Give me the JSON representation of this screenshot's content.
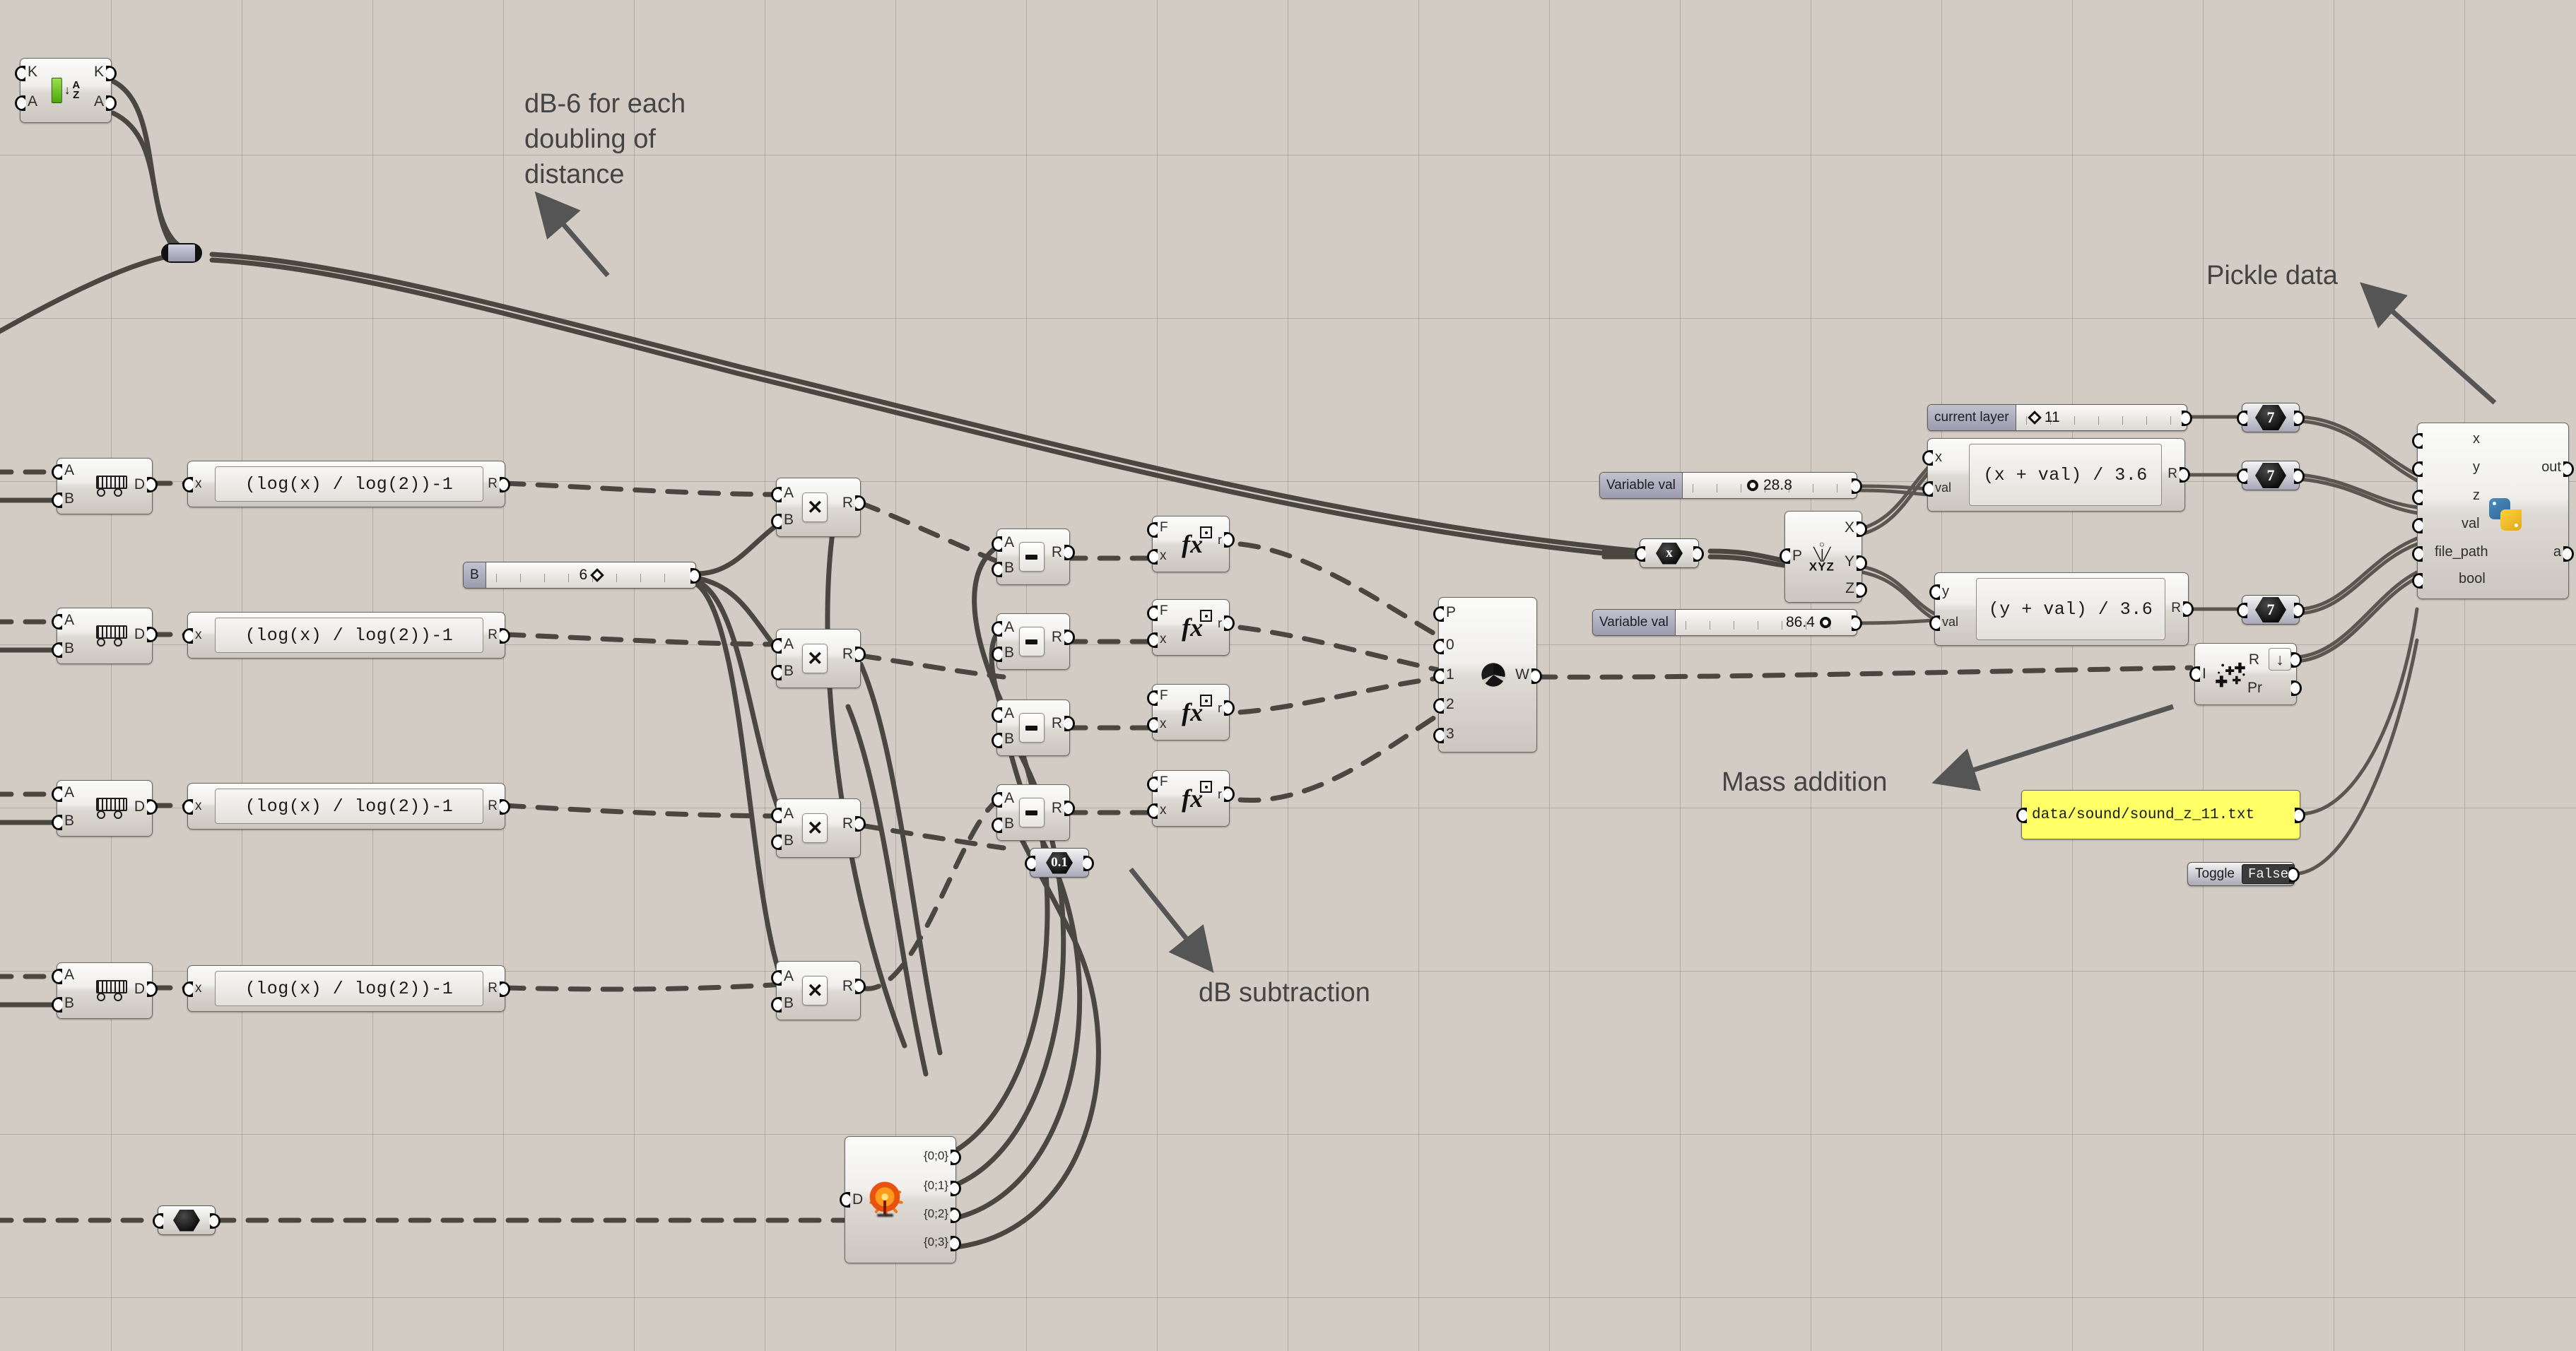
{
  "app": {
    "canvas_background": "#d3ccc4",
    "grid_line_color": "#827a70"
  },
  "annotations": [
    {
      "id": "db6",
      "text": "dB-6 for each\ndoubling of\ndistance"
    },
    {
      "id": "pickle",
      "text": "Pickle data"
    },
    {
      "id": "mass",
      "text": "Mass addition"
    },
    {
      "id": "dbsub",
      "text": "dB subtraction"
    }
  ],
  "nodes": {
    "sort": {
      "name": "sort-component",
      "icon": "sort-az-icon",
      "inputs": [
        "K",
        "A"
      ],
      "outputs": [
        "K",
        "A"
      ]
    },
    "relay": {
      "name": "wire-relay",
      "icon": "relay-icon"
    },
    "distance": {
      "name": "distance-component",
      "icon": "ruler-icon",
      "inputs": [
        "A",
        "B"
      ],
      "outputs": [
        "D"
      ]
    },
    "expr_log": {
      "name": "expression-component",
      "icon": "expression-icon",
      "inputs": [
        "x"
      ],
      "outputs": [
        "R"
      ],
      "expression": "(log(x) / log(2))-1"
    },
    "slider_b": {
      "name": "number-slider-b",
      "label": "B",
      "value": "6",
      "handle": "diamond"
    },
    "multiply": {
      "name": "multiplication-component",
      "icon": "multiply-icon",
      "inputs": [
        "A",
        "B"
      ],
      "outputs": [
        "R"
      ],
      "glyph": "✕"
    },
    "subtract": {
      "name": "subtraction-component",
      "icon": "minus-icon",
      "inputs": [
        "A",
        "B"
      ],
      "outputs": [
        "R"
      ],
      "glyph": "−"
    },
    "evaluate": {
      "name": "evaluate-component",
      "icon": "fx-icon",
      "inputs": [
        "F",
        "x"
      ],
      "outputs": [
        "r"
      ],
      "glyph": "fx"
    },
    "weave": {
      "name": "weave-component",
      "icon": "weave-spiral-icon",
      "inputs": [
        "P",
        "0",
        "1",
        "2",
        "3"
      ],
      "outputs": [
        "W"
      ]
    },
    "num_01": {
      "name": "number-param-point-one",
      "value": "0.1"
    },
    "num_empty": {
      "name": "number-param-empty",
      "value": ""
    },
    "explode_tree": {
      "name": "explode-tree-component",
      "icon": "explode-tree-icon",
      "inputs": [
        "D"
      ],
      "outputs": [
        "{0;0}",
        "{0;1}",
        "{0;2}",
        "{0;3}"
      ]
    },
    "point_param": {
      "name": "point-parameter",
      "glyph": "x"
    },
    "deconstruct": {
      "name": "deconstruct-point-component",
      "icon": "xyz-icon",
      "inputs": [
        "P"
      ],
      "outputs": [
        "X",
        "Y",
        "Z"
      ],
      "icon_label": "XYZ"
    },
    "slider_var_x": {
      "name": "number-slider-variable-val-x",
      "label": "Variable val",
      "value": "28.8",
      "handle": "circle"
    },
    "slider_var_y": {
      "name": "number-slider-variable-val-y",
      "label": "Variable val",
      "value": "86.4",
      "handle": "circle"
    },
    "slider_layer": {
      "name": "number-slider-current-layer",
      "label": "current layer",
      "value": "11",
      "handle": "diamond"
    },
    "expr_x": {
      "name": "expression-component-x",
      "inputs": [
        "x",
        "val"
      ],
      "outputs": [
        "R"
      ],
      "expression": "(x + val) / 3.6"
    },
    "expr_y": {
      "name": "expression-component-y",
      "inputs": [
        "y",
        "val"
      ],
      "outputs": [
        "R"
      ],
      "expression": "(y + val) / 3.6"
    },
    "num_7a": {
      "name": "number-param-seven-a",
      "value": "7"
    },
    "num_7b": {
      "name": "number-param-seven-b",
      "value": "7"
    },
    "num_7c": {
      "name": "number-param-seven-c",
      "value": "7"
    },
    "mass_addition": {
      "name": "mass-addition-component",
      "icon": "mass-addition-icon",
      "inputs": [
        "I"
      ],
      "outputs": [
        "R",
        "Pr"
      ],
      "extra_icon": "download-icon",
      "extra_glyph": "↓"
    },
    "python": {
      "name": "ghpython-component",
      "icon": "python-icon",
      "inputs": [
        "x",
        "y",
        "z",
        "val",
        "file_path",
        "bool"
      ],
      "outputs": [
        "out",
        "a"
      ]
    },
    "file_panel": {
      "name": "file-path-panel",
      "text": "data/sound/sound_z_11.txt",
      "color": "#ffff66"
    },
    "toggle": {
      "name": "boolean-toggle",
      "label": "Toggle",
      "value": "False"
    }
  }
}
